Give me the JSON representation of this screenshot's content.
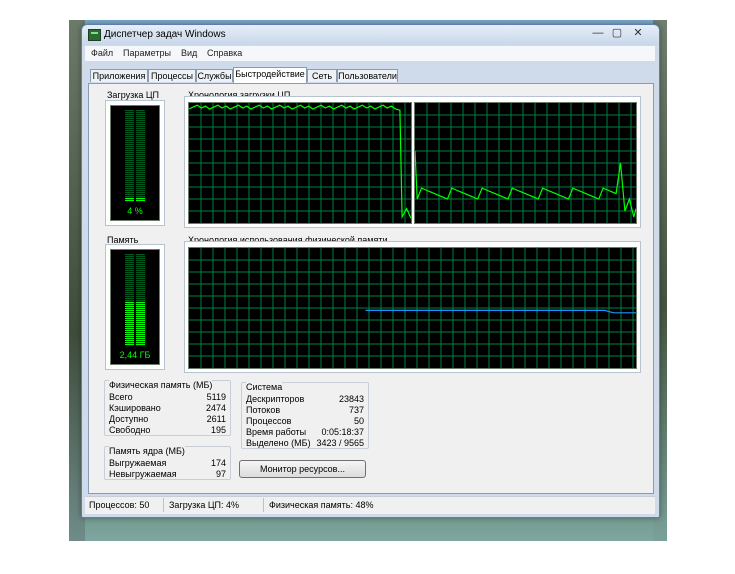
{
  "window": {
    "title": "Диспетчер задач Windows",
    "min": "—",
    "max": "▢",
    "close": "✕"
  },
  "menu": [
    "Файл",
    "Параметры",
    "Вид",
    "Справка"
  ],
  "tabs": [
    "Приложения",
    "Процессы",
    "Службы",
    "Быстродействие",
    "Сеть",
    "Пользователи"
  ],
  "active_tab": 3,
  "cpu": {
    "label": "Загрузка ЦП",
    "value_text": "4 %",
    "level": 0.04,
    "history_label": "Хронология загрузки ЦП"
  },
  "memory": {
    "label": "Память",
    "value_text": "2,44 ГБ",
    "level": 0.48,
    "history_label": "Хронология использования физической памяти"
  },
  "physical_memory": {
    "title": "Физическая память (МБ)",
    "rows": [
      {
        "k": "Всего",
        "v": "5119"
      },
      {
        "k": "Кэшировано",
        "v": "2474"
      },
      {
        "k": "Доступно",
        "v": "2611"
      },
      {
        "k": "Свободно",
        "v": "195"
      }
    ]
  },
  "kernel_memory": {
    "title": "Память ядра (МБ)",
    "rows": [
      {
        "k": "Выгружаемая",
        "v": "174"
      },
      {
        "k": "Невыгружаемая",
        "v": "97"
      }
    ]
  },
  "system": {
    "title": "Система",
    "rows": [
      {
        "k": "Дескрипторов",
        "v": "23843"
      },
      {
        "k": "Потоков",
        "v": "737"
      },
      {
        "k": "Процессов",
        "v": "50"
      },
      {
        "k": "Время работы",
        "v": "0:05:18:37"
      },
      {
        "k": "Выделено (МБ)",
        "v": "3423 / 9565"
      }
    ]
  },
  "monitor_button": "Монитор ресурсов...",
  "status": {
    "processes": "Процессов: 50",
    "cpu": "Загрузка ЦП: 4%",
    "memory": "Физическая память: 48%"
  },
  "colors": {
    "graph_bg": "#000000",
    "grid": "#008040",
    "meter_on": "#00ff00",
    "meter_off": "#005a1e",
    "cpu_line": "#00ff00",
    "memory_line": "#1e90ff"
  }
}
